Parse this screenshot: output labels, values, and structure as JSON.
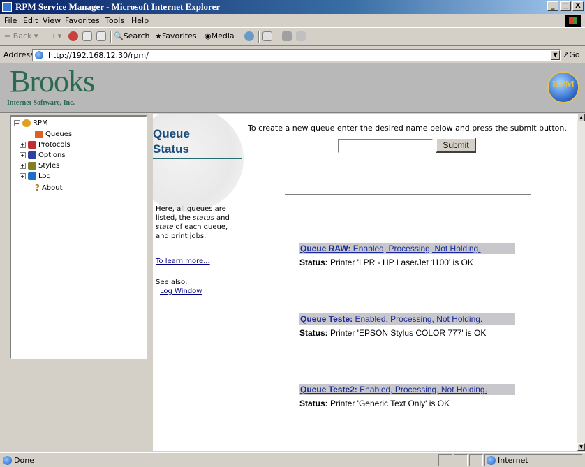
{
  "window": {
    "title": "RPM Service Manager - Microsoft Internet Explorer",
    "min": "_",
    "max": "□",
    "close": "X"
  },
  "menu": [
    "File",
    "Edit",
    "View",
    "Favorites",
    "Tools",
    "Help"
  ],
  "toolbar": {
    "back": "Back",
    "forward": "→",
    "search": "Search",
    "favorites": "Favorites",
    "media": "Media"
  },
  "address": {
    "label": "Address",
    "url": "http://192.168.12.30/rpm/",
    "go": "Go"
  },
  "banner": {
    "brand": "Brooks",
    "brand_sub": "Internet Software, Inc.",
    "badge": "RPM"
  },
  "tree": {
    "root": "RPM",
    "items": [
      {
        "label": "Queues",
        "icon": "queues-icon",
        "color": "#e06020"
      },
      {
        "label": "Protocols",
        "icon": "protocols-icon",
        "color": "#c03030"
      },
      {
        "label": "Options",
        "icon": "options-icon",
        "color": "#3040a0"
      },
      {
        "label": "Styles",
        "icon": "styles-icon",
        "color": "#808020"
      },
      {
        "label": "Log",
        "icon": "log-icon",
        "color": "#2070c0"
      },
      {
        "label": "About",
        "icon": "question-icon",
        "color": "#b08020"
      }
    ]
  },
  "page": {
    "title_line1": "Queue",
    "title_line2": "Status",
    "create_text": "To create a new queue enter the desired name below and press the submit button.",
    "submit_label": "Submit",
    "side_desc_1": "Here, all queues are listed, the ",
    "side_desc_status": "status",
    "side_desc_2": " and ",
    "side_desc_state": "state",
    "side_desc_3": " of each queue, and print jobs.",
    "learn_more": "To learn more...",
    "see_also": "See also:",
    "log_window": "Log Window"
  },
  "queues": [
    {
      "name": "Queue RAW:",
      "state": " Enabled, Processing, Not Holding.",
      "status_label": "Status:",
      "status": " Printer 'LPR - HP LaserJet 1100' is OK"
    },
    {
      "name": "Queue Teste:",
      "state": " Enabled, Processing, Not Holding.",
      "status_label": "Status:",
      "status": " Printer 'EPSON Stylus COLOR 777' is OK"
    },
    {
      "name": "Queue Teste2:",
      "state": " Enabled, Processing, Not Holding.",
      "status_label": "Status:",
      "status": " Printer 'Generic Text Only' is OK"
    }
  ],
  "statusbar": {
    "text": "Done",
    "zone": "Internet"
  }
}
